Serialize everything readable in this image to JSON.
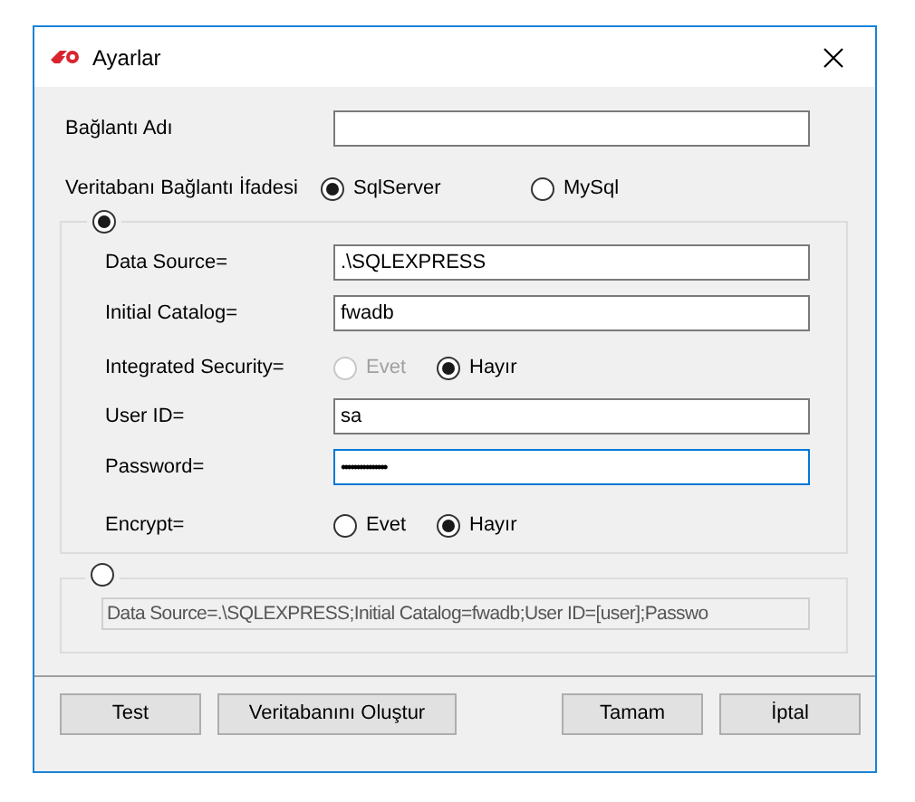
{
  "window": {
    "title": "Ayarlar"
  },
  "connection_name": {
    "label": "Bağlantı Adı"
  },
  "database_type": {
    "label": "Veritabanı Bağlantı İfadesi",
    "options": [
      {
        "label": "SqlServer",
        "selected": true
      },
      {
        "label": "MySql",
        "selected": false
      }
    ]
  },
  "builder_group": {
    "selected": true,
    "fields": [
      {
        "kind": "text",
        "label": "Data Source=",
        "value": ".\\SQLEXPRESS",
        "focused": false
      },
      {
        "kind": "text",
        "label": "Initial Catalog=",
        "value": "fwadb",
        "focused": false
      },
      {
        "kind": "radio",
        "label": "Integrated Security=",
        "options": [
          {
            "label": "Evet",
            "selected": false,
            "disabled": true
          },
          {
            "label": "Hayır",
            "selected": true,
            "disabled": false
          }
        ]
      },
      {
        "kind": "text",
        "label": "User ID=",
        "value": "sa",
        "focused": false
      },
      {
        "kind": "password",
        "label": "Password=",
        "value": "•••••••••••••••",
        "focused": true
      },
      {
        "kind": "radio",
        "label": "Encrypt=",
        "options": [
          {
            "label": "Evet",
            "selected": false,
            "disabled": false
          },
          {
            "label": "Hayır",
            "selected": true,
            "disabled": false
          }
        ]
      }
    ]
  },
  "string_group": {
    "selected": false,
    "disabled": true,
    "value": "Data Source=.\\SQLEXPRESS;Initial Catalog=fwadb;User ID=[user];Passwo"
  },
  "buttons": [
    {
      "label": "Test"
    },
    {
      "label": "Veritabanını Oluştur"
    },
    {
      "label": "Tamam"
    },
    {
      "label": "İptal"
    }
  ]
}
